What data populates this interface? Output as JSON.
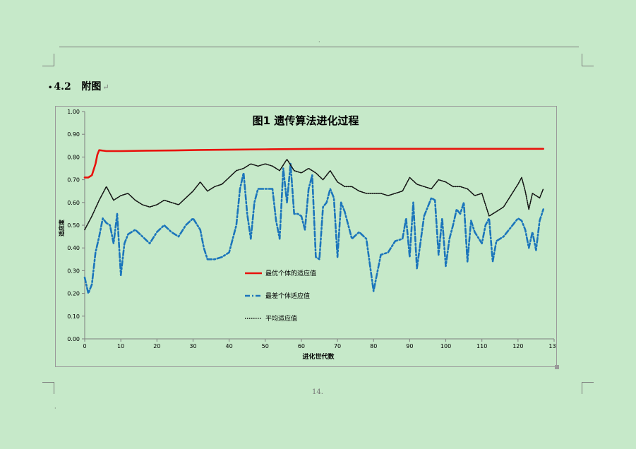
{
  "page": {
    "top_marker": "·",
    "heading_bullet": "•",
    "heading_number": "4.2",
    "heading_text": "附图",
    "return_mark": "↵",
    "page_number": "14.",
    "footer_marker": "·"
  },
  "chart_data": {
    "type": "line",
    "title": "图1  遗传算法进化过程",
    "xlabel": "进化世代数",
    "ylabel": "适应度",
    "xlim": [
      0,
      130
    ],
    "ylim": [
      0,
      1.0
    ],
    "xticks": [
      0,
      10,
      20,
      30,
      40,
      50,
      60,
      70,
      80,
      90,
      100,
      110,
      120,
      130
    ],
    "yticks": [
      "0.00",
      "0.10",
      "0.20",
      "0.30",
      "0.40",
      "0.50",
      "0.60",
      "0.70",
      "0.80",
      "0.90",
      "1.00"
    ],
    "grid": false,
    "legend_position": "inside-lower-center",
    "series": [
      {
        "name": "最优个体的适应值",
        "color": "#e8120c",
        "style": "solid",
        "x": [
          0,
          1,
          2,
          3,
          3.5,
          4,
          6,
          10,
          17,
          25,
          32,
          44,
          50,
          60,
          68,
          75,
          85,
          100,
          110,
          120,
          127
        ],
        "y": [
          0.71,
          0.71,
          0.72,
          0.77,
          0.81,
          0.83,
          0.826,
          0.826,
          0.828,
          0.829,
          0.831,
          0.833,
          0.834,
          0.835,
          0.836,
          0.836,
          0.836,
          0.836,
          0.836,
          0.836,
          0.836
        ]
      },
      {
        "name": "最差个体适应值",
        "color": "#1b75bb",
        "style": "dashdot",
        "x": [
          0,
          1,
          2,
          3,
          4,
          5,
          6,
          7,
          8,
          9,
          10,
          11,
          12,
          14,
          16,
          18,
          20,
          22,
          24,
          26,
          28,
          30,
          32,
          33,
          34,
          36,
          38,
          40,
          42,
          43,
          44,
          45,
          46,
          47,
          48,
          50,
          52,
          53,
          54,
          55,
          56,
          57,
          58,
          59,
          60,
          61,
          62,
          63,
          64,
          65,
          66,
          67,
          68,
          69,
          70,
          71,
          72,
          74,
          76,
          78,
          80,
          82,
          84,
          86,
          88,
          89,
          90,
          91,
          92,
          94,
          96,
          97,
          98,
          99,
          100,
          101,
          102,
          103,
          104,
          105,
          106,
          107,
          108,
          110,
          111,
          112,
          113,
          114,
          116,
          118,
          120,
          121,
          122,
          123,
          124,
          125,
          126,
          127
        ],
        "y": [
          0.27,
          0.2,
          0.24,
          0.38,
          0.45,
          0.53,
          0.51,
          0.5,
          0.42,
          0.55,
          0.28,
          0.42,
          0.46,
          0.48,
          0.45,
          0.42,
          0.47,
          0.5,
          0.47,
          0.45,
          0.5,
          0.53,
          0.48,
          0.4,
          0.35,
          0.35,
          0.36,
          0.38,
          0.5,
          0.66,
          0.73,
          0.55,
          0.44,
          0.6,
          0.66,
          0.66,
          0.66,
          0.52,
          0.44,
          0.75,
          0.6,
          0.77,
          0.55,
          0.55,
          0.54,
          0.48,
          0.66,
          0.72,
          0.36,
          0.35,
          0.58,
          0.6,
          0.66,
          0.62,
          0.36,
          0.6,
          0.56,
          0.44,
          0.47,
          0.44,
          0.21,
          0.37,
          0.38,
          0.43,
          0.44,
          0.53,
          0.36,
          0.6,
          0.31,
          0.54,
          0.62,
          0.61,
          0.37,
          0.53,
          0.32,
          0.44,
          0.5,
          0.57,
          0.55,
          0.6,
          0.34,
          0.52,
          0.47,
          0.42,
          0.5,
          0.53,
          0.34,
          0.43,
          0.45,
          0.49,
          0.53,
          0.52,
          0.48,
          0.4,
          0.47,
          0.39,
          0.52,
          0.57
        ]
      },
      {
        "name": "平均适应值",
        "color": "#111111",
        "style": "dotted",
        "x": [
          0,
          2,
          4,
          6,
          8,
          10,
          12,
          14,
          16,
          18,
          20,
          22,
          24,
          26,
          28,
          30,
          32,
          34,
          36,
          38,
          40,
          42,
          44,
          46,
          48,
          50,
          52,
          54,
          56,
          58,
          60,
          62,
          64,
          66,
          68,
          70,
          72,
          74,
          76,
          78,
          80,
          82,
          84,
          86,
          88,
          90,
          92,
          94,
          96,
          98,
          100,
          102,
          104,
          106,
          108,
          110,
          112,
          114,
          116,
          118,
          120,
          121,
          122,
          123,
          124,
          125,
          126,
          127
        ],
        "y": [
          0.48,
          0.54,
          0.61,
          0.67,
          0.61,
          0.63,
          0.64,
          0.61,
          0.59,
          0.58,
          0.59,
          0.61,
          0.6,
          0.59,
          0.62,
          0.65,
          0.69,
          0.65,
          0.67,
          0.68,
          0.71,
          0.74,
          0.75,
          0.77,
          0.76,
          0.77,
          0.76,
          0.74,
          0.79,
          0.74,
          0.73,
          0.75,
          0.73,
          0.7,
          0.74,
          0.69,
          0.67,
          0.67,
          0.65,
          0.64,
          0.64,
          0.64,
          0.63,
          0.64,
          0.65,
          0.71,
          0.68,
          0.67,
          0.66,
          0.7,
          0.69,
          0.67,
          0.67,
          0.66,
          0.63,
          0.64,
          0.54,
          0.56,
          0.58,
          0.63,
          0.68,
          0.71,
          0.65,
          0.57,
          0.64,
          0.63,
          0.62,
          0.66
        ]
      }
    ]
  }
}
